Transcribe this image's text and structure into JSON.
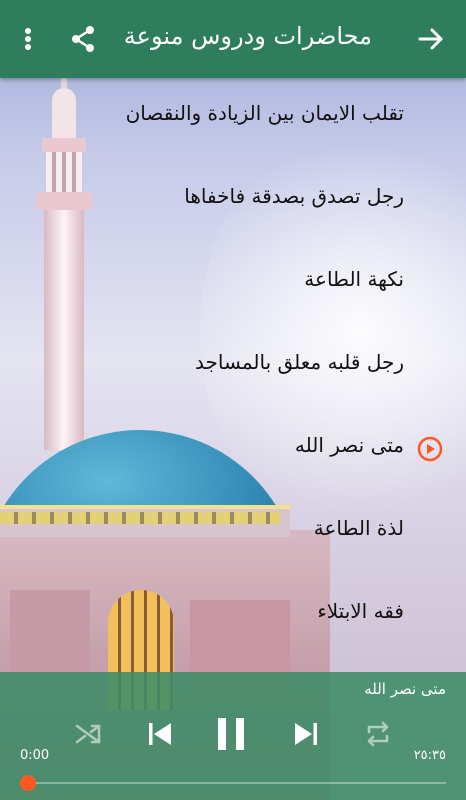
{
  "header": {
    "title": "محاضرات ودروس منوعة",
    "back_icon": "arrow-right-icon",
    "share_icon": "share-icon",
    "menu_icon": "more-vert-icon",
    "color": "#2e7d5c"
  },
  "lectures": [
    {
      "title": "تقلب الايمان بين الزيادة والنقصان",
      "playing": false
    },
    {
      "title": "رجل تصدق بصدقة فاخفاها",
      "playing": false
    },
    {
      "title": "نكهة الطاعة",
      "playing": false
    },
    {
      "title": "رجل قلبه معلق بالمساجد",
      "playing": false
    },
    {
      "title": "متى نصر الله",
      "playing": true
    },
    {
      "title": "لذة الطاعة",
      "playing": false
    },
    {
      "title": "فقه الابتلاء",
      "playing": false
    }
  ],
  "player": {
    "now_playing": "متى نصر الله",
    "current_time": "0:00",
    "total_time": "٢٥:٣٥",
    "progress": 0.0,
    "accent": "#ff5722",
    "controls": [
      "shuffle-icon",
      "skip-previous-icon",
      "pause-icon",
      "skip-next-icon",
      "repeat-icon"
    ]
  }
}
